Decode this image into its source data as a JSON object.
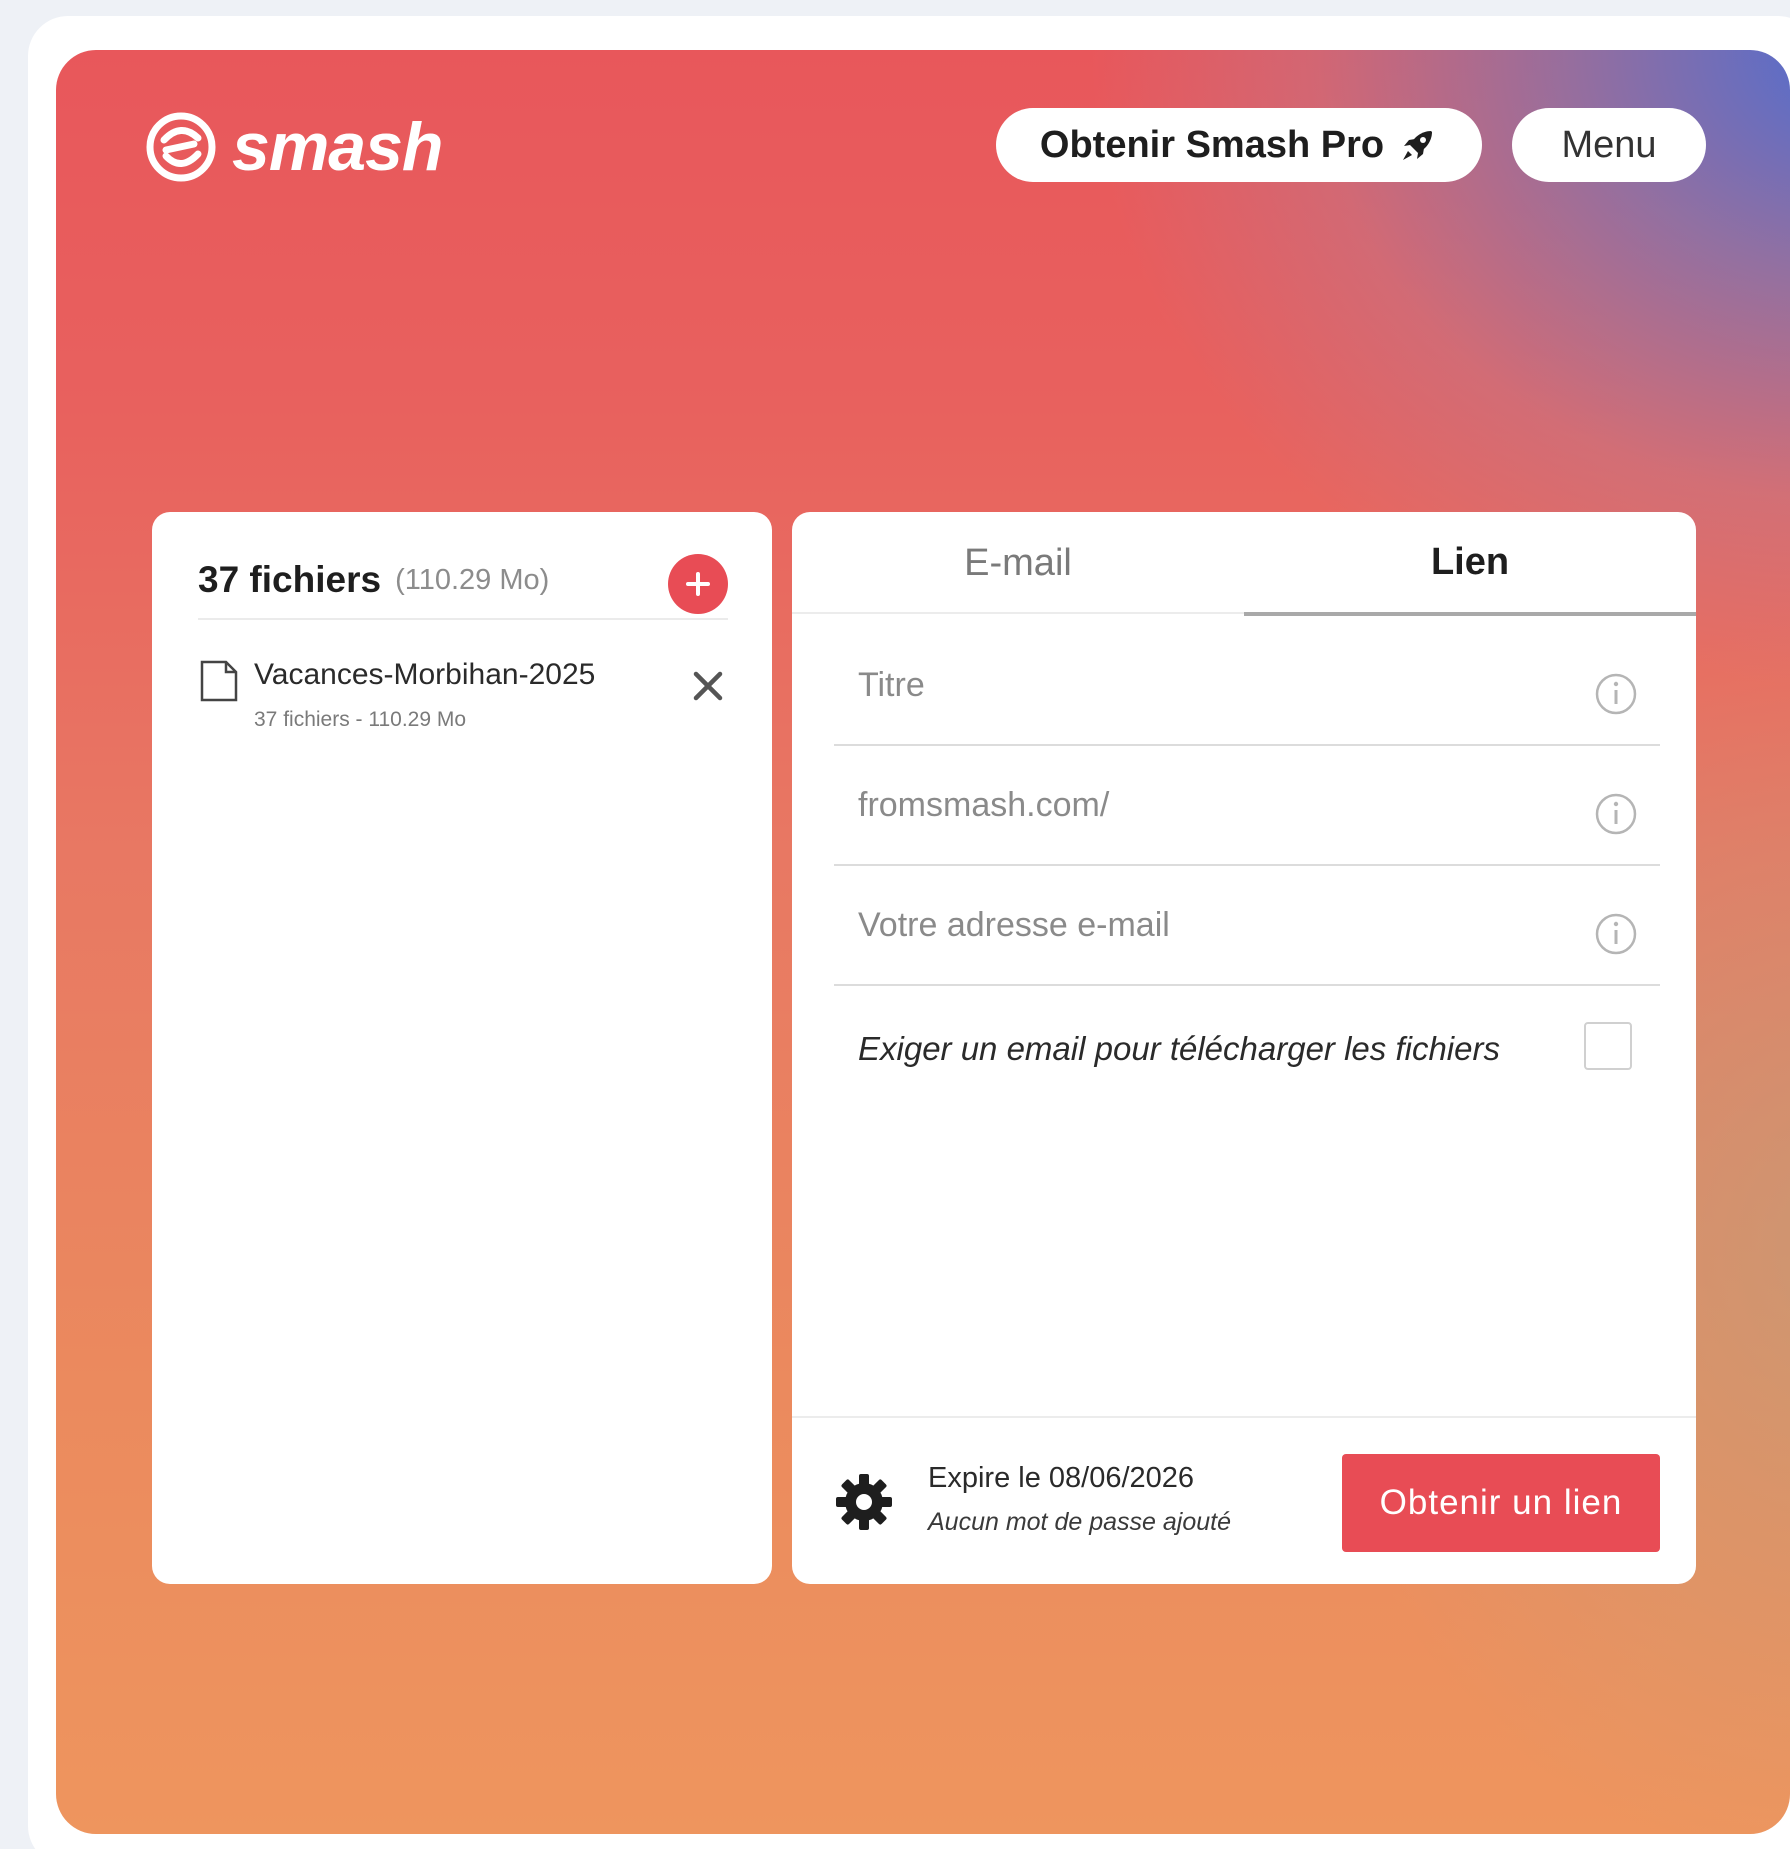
{
  "header": {
    "logo_text": "smash",
    "pro_button_label": "Obtenir Smash Pro",
    "menu_button_label": "Menu"
  },
  "files": {
    "count_label": "37 fichiers",
    "total_size": "(110.29 Mo)",
    "items": [
      {
        "name": "Vacances-Morbihan-2025",
        "meta": "37 fichiers - 110.29 Mo"
      }
    ]
  },
  "share": {
    "tabs": [
      {
        "label": "E-mail",
        "active": false
      },
      {
        "label": "Lien",
        "active": true
      }
    ],
    "fields": {
      "title_placeholder": "Titre",
      "url_placeholder": "fromsmash.com/",
      "email_placeholder": "Votre adresse e-mail"
    },
    "require_email_label": "Exiger un email pour télécharger les fichiers",
    "require_email_checked": false,
    "footer": {
      "expire_text": "Expire le 08/06/2026",
      "password_text": "Aucun mot de passe ajouté",
      "get_link_label": "Obtenir un lien"
    }
  },
  "colors": {
    "accent": "#e84c55",
    "gradient_top_left": "#e8575b",
    "gradient_top_right": "#4a6ed6",
    "gradient_bottom": "#ee955e"
  },
  "icons": [
    "smash-logo-icon",
    "rocket-icon",
    "add-icon",
    "file-icon",
    "close-icon",
    "info-icon",
    "gear-icon"
  ]
}
